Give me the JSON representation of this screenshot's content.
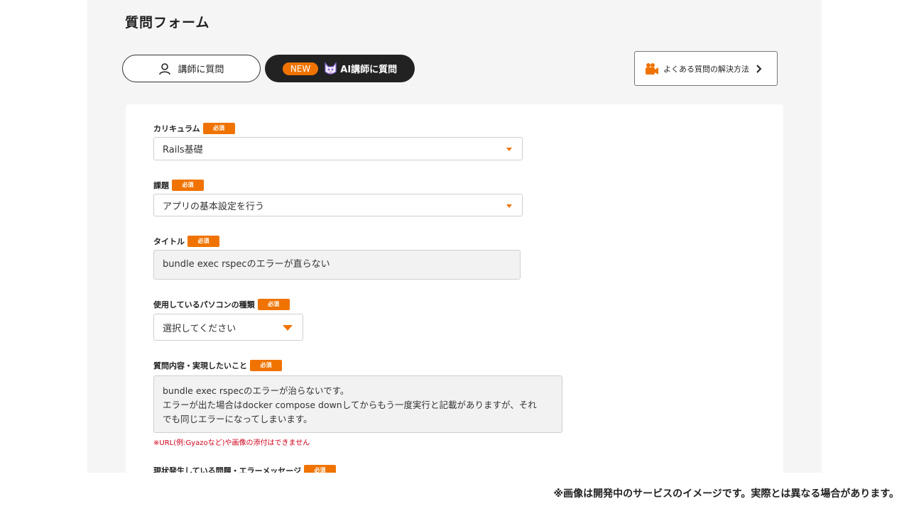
{
  "page": {
    "title": "質問フォーム"
  },
  "tabs": {
    "teacher_label": "講師に質問",
    "new_badge": "NEW",
    "ai_label": "AI講師に質問"
  },
  "faq": {
    "label": "よくある質問の解決方法"
  },
  "form": {
    "required_label": "必須",
    "curriculum": {
      "label": "カリキュラム",
      "value": "Rails基礎"
    },
    "task": {
      "label": "課題",
      "value": "アプリの基本設定を行う"
    },
    "title": {
      "label": "タイトル",
      "value": "bundle exec rspecのエラーが直らない"
    },
    "pc_type": {
      "label": "使用しているパソコンの種類",
      "value": "選択してください"
    },
    "content": {
      "label": "質問内容・実現したいこと",
      "lines": [
        "bundle exec rspecのエラーが治らないです。",
        "エラーが出た場合はdocker compose downしてからもう一度実行と記載がありますが、それ",
        "でも同じエラーになってしまいます。"
      ]
    },
    "attachment_note": "※URL(例:Gyazoなど)や画像の添付はできません",
    "current_issue": {
      "label": "現状発生している問題・エラーメッセージ"
    }
  },
  "footer": {
    "disclaimer": "※画像は開発中のサービスのイメージです。実際とは異なる場合があります。"
  },
  "colors": {
    "accent": "#f07300",
    "dark": "#222222",
    "error": "#d0021b"
  }
}
